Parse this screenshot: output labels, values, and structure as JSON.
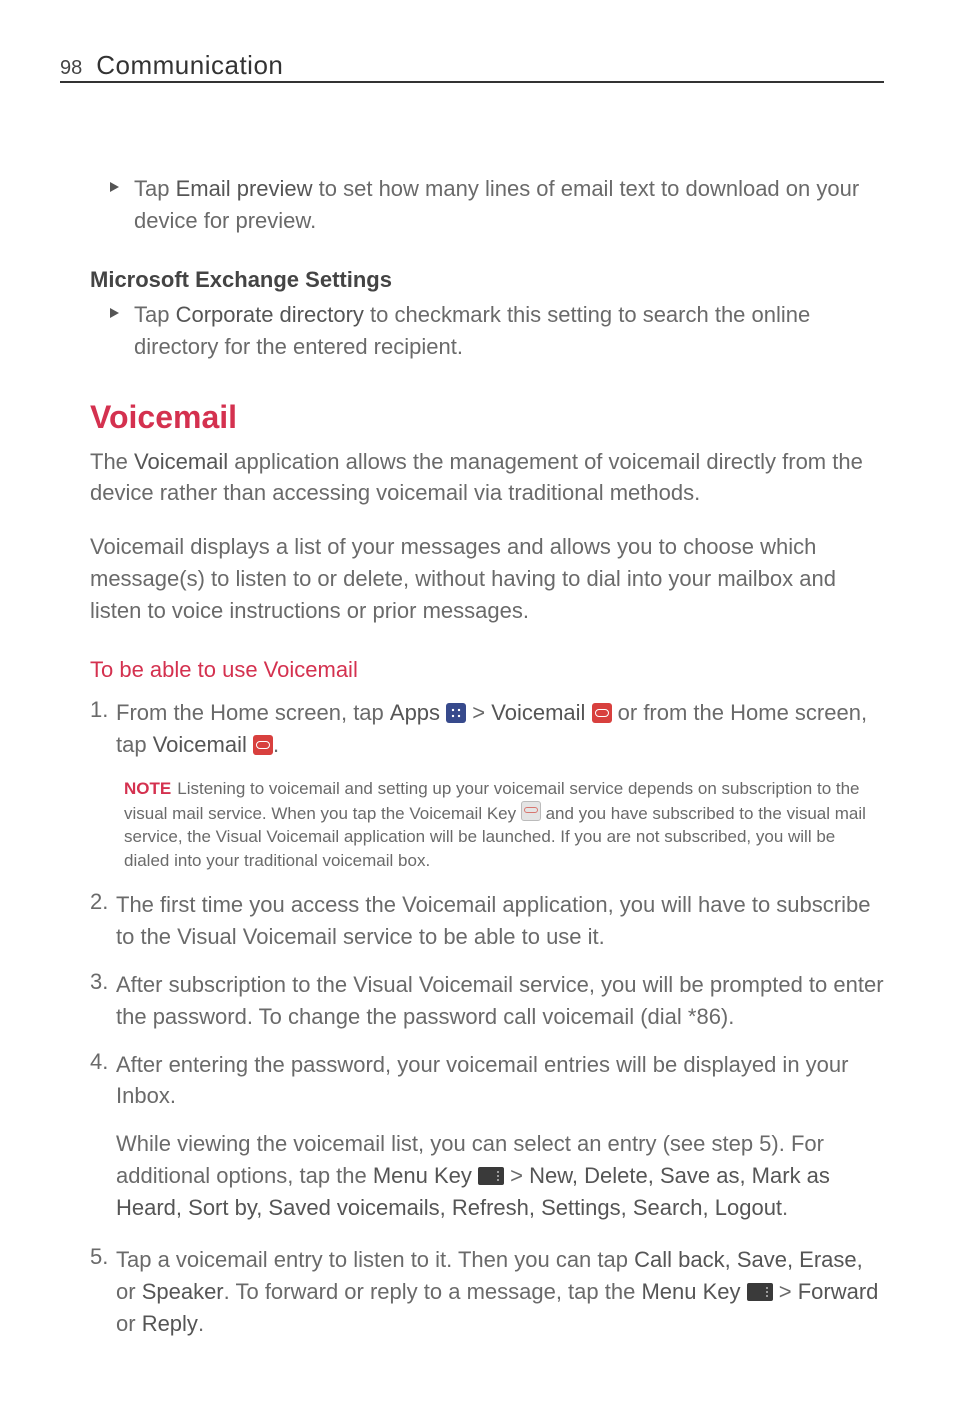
{
  "header": {
    "page_number": "98",
    "title": "Communication"
  },
  "bullets": {
    "email_preview_a": "Tap ",
    "email_preview_bold": "Email preview",
    "email_preview_b": " to set how many lines of email text to download on your device for preview.",
    "corp_dir_a": "Tap ",
    "corp_dir_bold": "Corporate directory",
    "corp_dir_b": " to checkmark this setting to search the online directory for the entered recipient."
  },
  "subheads": {
    "ms_exchange": "Microsoft Exchange Settings"
  },
  "voicemail": {
    "heading": "Voicemail",
    "p1_a": "The ",
    "p1_bold": "Voicemail",
    "p1_b": " application allows the management of voicemail directly from the device rather than accessing voicemail via traditional methods.",
    "p2": "Voicemail displays a list of your messages and allows you to choose which message(s) to listen to or delete, without having to dial into your mailbox and listen to voice instructions or prior messages.",
    "subhead": "To be able to use Voicemail"
  },
  "steps": {
    "s1_a": "From the Home screen, tap ",
    "s1_apps": "Apps",
    "s1_gt1": " > ",
    "s1_vm": "Voicemail",
    "s1_b": " or from the Home screen, tap ",
    "s1_vm2": "Voicemail",
    "s1_end": ".",
    "note_label": "NOTE",
    "note_a": "Listening to voicemail and setting up your voicemail service depends on subscription to the visual mail service.  When you tap the Voicemail Key ",
    "note_b": " and you have subscribed to the visual mail service, the Visual Voicemail application will be launched. If you are not subscribed, you will be dialed into your traditional voicemail box.",
    "s2": "The first time you access the Voicemail application, you will have to subscribe to the Visual Voicemail service to be able to use it.",
    "s3": "After subscription to the Visual Voicemail service, you will be prompted to enter the password. To change the password call voicemail (dial *86).",
    "s4": "After entering the password, your voicemail entries will be displayed in your Inbox.",
    "s4b_a": "While viewing the voicemail list, you can select an entry (see step 5). For additional options, tap the ",
    "s4b_menu": "Menu Key",
    "s4b_gt": " > ",
    "s4b_opts": "New, Delete, Save as, Mark as Heard, Sort by, Saved voicemails, Refresh, Settings, Search, Logout",
    "s4b_end": ".",
    "s5_a": "Tap a voicemail entry to listen to it. Then you can tap ",
    "s5_opts1": "Call back, Save, Erase,",
    "s5_or": " or ",
    "s5_spk": "Speaker",
    "s5_b": ". To forward or reply to a message, tap the ",
    "s5_menu": "Menu Key",
    "s5_gt": " > ",
    "s5_fwd": "Forward",
    "s5_or2": " or ",
    "s5_reply": "Reply",
    "s5_end": "."
  },
  "nums": {
    "n1": "1.",
    "n2": "2.",
    "n3": "3.",
    "n4": "4.",
    "n5": "5."
  }
}
